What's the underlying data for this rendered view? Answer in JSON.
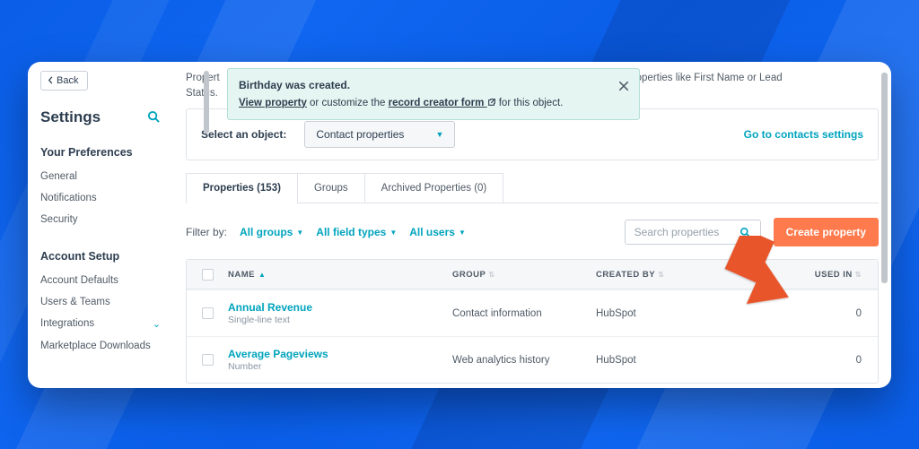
{
  "sidebar": {
    "back": "Back",
    "title": "Settings",
    "section1": "Your Preferences",
    "items1": [
      "General",
      "Notifications",
      "Security"
    ],
    "section2": "Account Setup",
    "items2": [
      "Account Defaults",
      "Users & Teams",
      "Integrations",
      "Marketplace Downloads"
    ]
  },
  "intro": {
    "prefix": "Propert",
    "suffix": "ight have properties like First Name or Lead",
    "line2": "Status."
  },
  "toast": {
    "title": "Birthday was created.",
    "link1": "View property",
    "mid1": " or customize the ",
    "link2": "record creator form",
    "mid2": " for this object."
  },
  "selector": {
    "label": "Select an object:",
    "value": "Contact properties",
    "goto": "Go to contacts settings"
  },
  "tabs": {
    "t1": "Properties (153)",
    "t2": "Groups",
    "t3": "Archived Properties (0)"
  },
  "filters": {
    "label": "Filter by:",
    "f1": "All groups",
    "f2": "All field types",
    "f3": "All users",
    "search_ph": "Search properties",
    "create": "Create property"
  },
  "table": {
    "h_name": "NAME",
    "h_group": "GROUP",
    "h_created": "CREATED BY",
    "h_used": "USED IN",
    "rows": [
      {
        "name": "Annual Revenue",
        "sub": "Single-line text",
        "group": "Contact information",
        "created": "HubSpot",
        "used": "0"
      },
      {
        "name": "Average Pageviews",
        "sub": "Number",
        "group": "Web analytics history",
        "created": "HubSpot",
        "used": "0"
      }
    ]
  }
}
